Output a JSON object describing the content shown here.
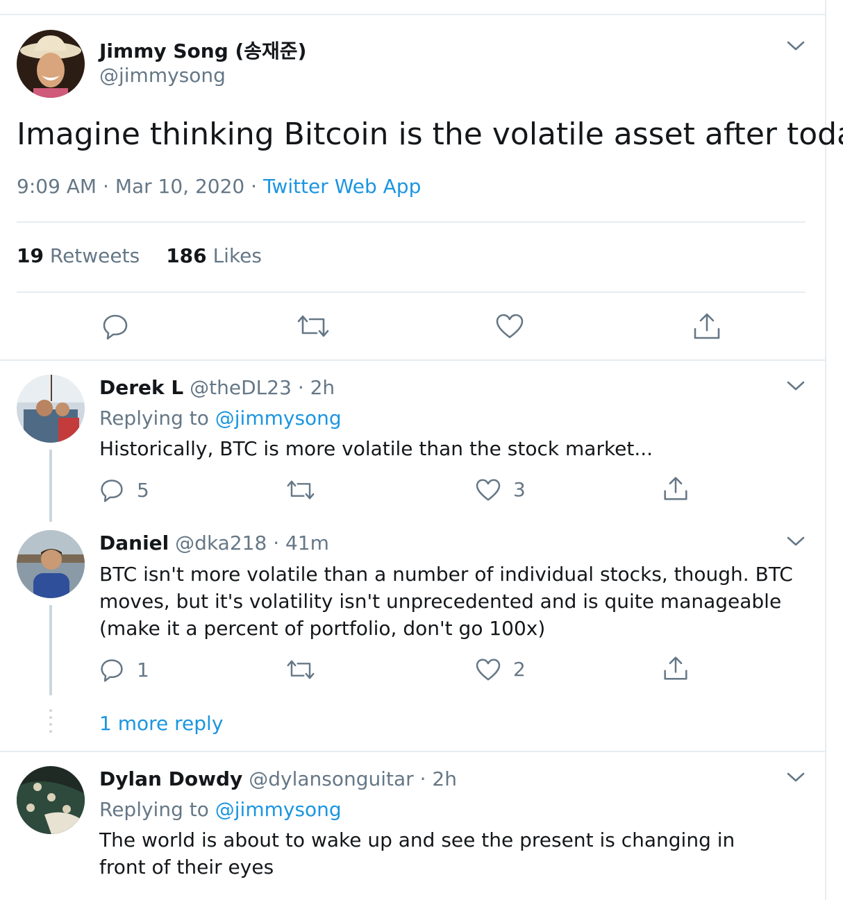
{
  "tweet": {
    "author_name": "Jimmy Song (송재준)",
    "author_handle": "@jimmysong",
    "text": "Imagine thinking Bitcoin is the volatile asset after today.",
    "time": "9:09 AM",
    "date": "Mar 10, 2020",
    "sep": "·",
    "source": "Twitter Web App",
    "retweets_count": "19",
    "retweets_label": "Retweets",
    "likes_count": "186",
    "likes_label": "Likes"
  },
  "replies": [
    {
      "name": "Derek L",
      "handle": "@theDL23",
      "time": "· 2h",
      "replying_label": "Replying to",
      "replying_to": "@jimmysong",
      "text": "Historically, BTC is more volatile than the stock market...",
      "reply_count": "5",
      "retweet_count": "",
      "like_count": "3"
    },
    {
      "name": "Daniel",
      "handle": "@dka218",
      "time": "· 41m",
      "text": "BTC isn't more volatile than a number of individual stocks, though. BTC moves, but it's volatility isn't unprecedented and is quite manageable (make it a percent of portfolio, don't go 100x)",
      "reply_count": "1",
      "retweet_count": "",
      "like_count": "2"
    },
    {
      "name": "Dylan Dowdy",
      "handle": "@dylansonguitar",
      "time": "· 2h",
      "replying_label": "Replying to",
      "replying_to": "@jimmysong",
      "text": "The world is about to wake up and see the present is changing in front of their eyes"
    }
  ],
  "thread": {
    "more_replies": "1 more reply"
  },
  "icons": {
    "reply": "reply-icon",
    "retweet": "retweet-icon",
    "like": "heart-icon",
    "share": "share-icon",
    "menu": "chevron-down-icon"
  },
  "colors": {
    "link": "#1b95e0",
    "muted": "#657786",
    "text": "#14171a",
    "divider": "#e6ecf0",
    "thread_line": "#ccd6dd"
  }
}
